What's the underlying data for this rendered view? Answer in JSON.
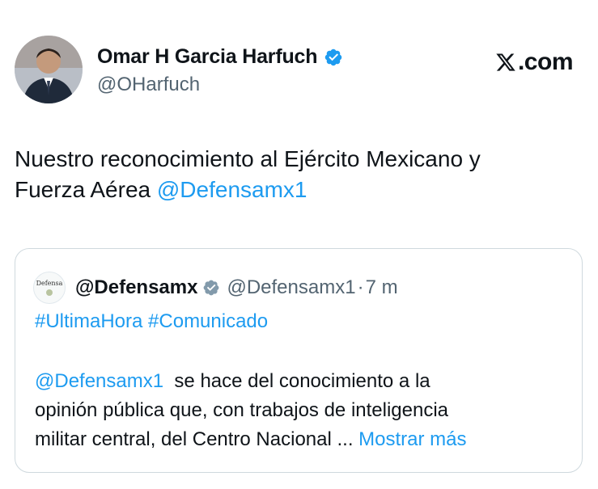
{
  "author": {
    "display_name": "Omar H Garcia Harfuch",
    "handle": "@OHarfuch"
  },
  "brand": {
    "logo_text": ".com",
    "logo_mark": "X"
  },
  "tweet": {
    "text_line1": "Nuestro reconocimiento al Ejército Mexicano y",
    "text_line2_prefix": "Fuerza Aérea ",
    "mention": "@Defensamx1"
  },
  "quoted": {
    "avatar_text": "Defensa",
    "display_name": "@Defensamx",
    "handle": "@Defensamx1",
    "separator": "·",
    "time": "7 m",
    "hashtags": "#UltimaHora #Comunicado",
    "body_mention": "@Defensamx1",
    "body_line1_rest": "  se hace del conocimiento a la",
    "body_line2": "opinión pública que, con trabajos de inteligencia",
    "body_line3": "militar central, del Centro Nacional ... ",
    "show_more": "Mostrar más"
  },
  "colors": {
    "link": "#1d9bf0",
    "secondary_text": "#536471",
    "primary_text": "#0f1419",
    "border": "#cfd9de"
  }
}
